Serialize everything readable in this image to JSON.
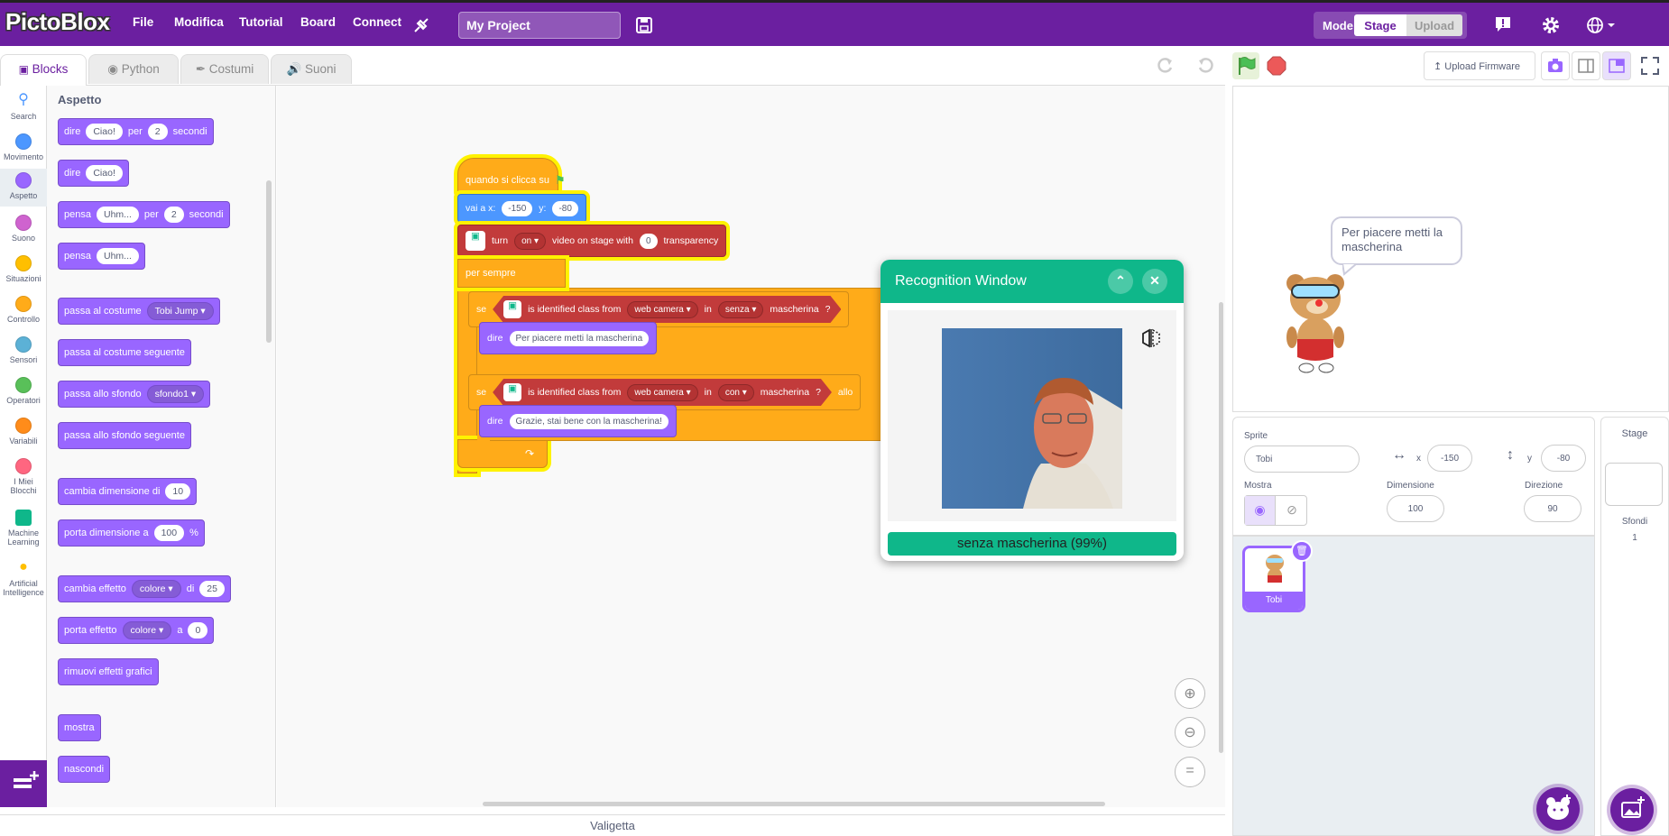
{
  "app": {
    "name": "PictoBlox"
  },
  "menubar": {
    "items": [
      "File",
      "Modifica",
      "Tutorial",
      "Board",
      "Connect"
    ],
    "project_title": "My Project",
    "mode_label": "Mode",
    "mode_stage": "Stage",
    "mode_upload": "Upload"
  },
  "tabs": {
    "blocks": "Blocks",
    "python": "Python",
    "costumes": "Costumi",
    "sounds": "Suoni"
  },
  "toolbar": {
    "upload_firmware": "Upload Firmware"
  },
  "categories": [
    {
      "label": "Search",
      "color": "#4c97ff"
    },
    {
      "label": "Movimento",
      "color": "#4c97ff"
    },
    {
      "label": "Aspetto",
      "color": "#9966ff"
    },
    {
      "label": "Suono",
      "color": "#cf63cf"
    },
    {
      "label": "Situazioni",
      "color": "#ffbf00"
    },
    {
      "label": "Controllo",
      "color": "#ffab19"
    },
    {
      "label": "Sensori",
      "color": "#5cb1d6"
    },
    {
      "label": "Operatori",
      "color": "#59c059"
    },
    {
      "label": "Variabili",
      "color": "#ff8c1a"
    },
    {
      "label": "I Miei Blocchi",
      "color": "#ff6680"
    },
    {
      "label": "Machine Learning",
      "color": "#0fb78a"
    },
    {
      "label": "Artificial Intelligence",
      "color": "#ffbf00"
    }
  ],
  "palette": {
    "title": "Aspetto",
    "b1": {
      "t1": "dire",
      "v1": "Ciao!",
      "t2": "per",
      "v2": "2",
      "t3": "secondi"
    },
    "b2": {
      "t1": "dire",
      "v1": "Ciao!"
    },
    "b3": {
      "t1": "pensa",
      "v1": "Uhm...",
      "t2": "per",
      "v2": "2",
      "t3": "secondi"
    },
    "b4": {
      "t1": "pensa",
      "v1": "Uhm..."
    },
    "b5": {
      "t1": "passa al costume",
      "v1": "Tobi Jump"
    },
    "b6": {
      "t1": "passa al costume seguente"
    },
    "b7": {
      "t1": "passa allo sfondo",
      "v1": "sfondo1"
    },
    "b8": {
      "t1": "passa allo sfondo seguente"
    },
    "b9": {
      "t1": "cambia dimensione di",
      "v1": "10"
    },
    "b10": {
      "t1": "porta dimensione a",
      "v1": "100",
      "t2": "%"
    },
    "b11": {
      "t1": "cambia effetto",
      "v1": "colore",
      "t2": "di",
      "v2": "25"
    },
    "b12": {
      "t1": "porta effetto",
      "v1": "colore",
      "t2": "a",
      "v2": "0"
    },
    "b13": {
      "t1": "rimuovi effetti grafici"
    },
    "b14": {
      "t1": "mostra"
    },
    "b15": {
      "t1": "nascondi"
    }
  },
  "script": {
    "hat": "quando si clicca su",
    "goto": {
      "t1": "vai a x:",
      "x": "-150",
      "t2": "y:",
      "y": "-80"
    },
    "video": {
      "t1": "turn",
      "v1": "on",
      "t2": "video on stage with",
      "v2": "0",
      "t3": "transparency"
    },
    "forever": "per sempre",
    "if1": {
      "se": "se",
      "t1": "is identified class from",
      "v1": "web camera",
      "t2": "in",
      "v2": "senza",
      "t3": "mascherina",
      "q": "?"
    },
    "say1": {
      "t1": "dire",
      "v1": "Per piacere metti la mascherina"
    },
    "if2": {
      "se": "se",
      "t1": "is identified class from",
      "v1": "web camera",
      "t2": "in",
      "v2": "con",
      "t3": "mascherina",
      "q": "?",
      "tail": "allo"
    },
    "say2": {
      "t1": "dire",
      "v1": "Grazie, stai bene con la mascherina!"
    }
  },
  "recognition": {
    "title": "Recognition Window",
    "result": "senza mascherina (99%)"
  },
  "stage": {
    "bubble": "Per piacere metti la mascherina"
  },
  "sprite_info": {
    "sprite_label": "Sprite",
    "sprite_name": "Tobi",
    "x_label": "x",
    "x": "-150",
    "y_label": "y",
    "y": "-80",
    "show_label": "Mostra",
    "size_label": "Dimensione",
    "size": "100",
    "direction_label": "Direzione",
    "direction": "90"
  },
  "sprites": [
    {
      "name": "Tobi"
    }
  ],
  "stage_panel": {
    "title": "Stage",
    "backdrops_label": "Sfondi",
    "backdrops_count": "1"
  },
  "backpack": {
    "label": "Valigetta"
  }
}
